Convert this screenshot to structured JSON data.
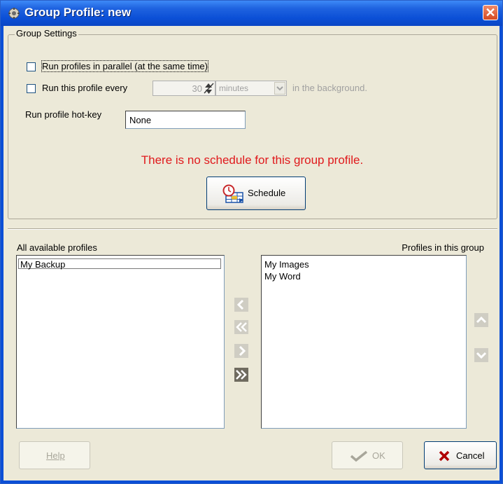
{
  "window": {
    "title": "Group Profile: new",
    "close_glyph": "✕"
  },
  "group_settings": {
    "legend": "Group Settings",
    "run_parallel_label": "Run profiles in parallel (at the same time)",
    "run_parallel_checked": false,
    "run_every_label": "Run this profile every",
    "run_every_checked": false,
    "interval_value": "30",
    "interval_unit": "minutes",
    "interval_suffix": "in the background.",
    "hotkey_label": "Run profile hot-key",
    "hotkey_value": "None"
  },
  "schedule": {
    "message": "There is no schedule for this group profile.",
    "button_label": "Schedule"
  },
  "available": {
    "header": "All available profiles",
    "items": [
      "My Backup"
    ]
  },
  "in_group": {
    "header": "Profiles in this group",
    "items": [
      "My Images",
      "My Word"
    ]
  },
  "footer": {
    "help_label": "Help",
    "ok_label": "OK",
    "cancel_label": "Cancel"
  },
  "colors": {
    "title_bar": "#0b4fd6",
    "dialog_bg": "#ece9d8",
    "message": "#e0191c"
  }
}
